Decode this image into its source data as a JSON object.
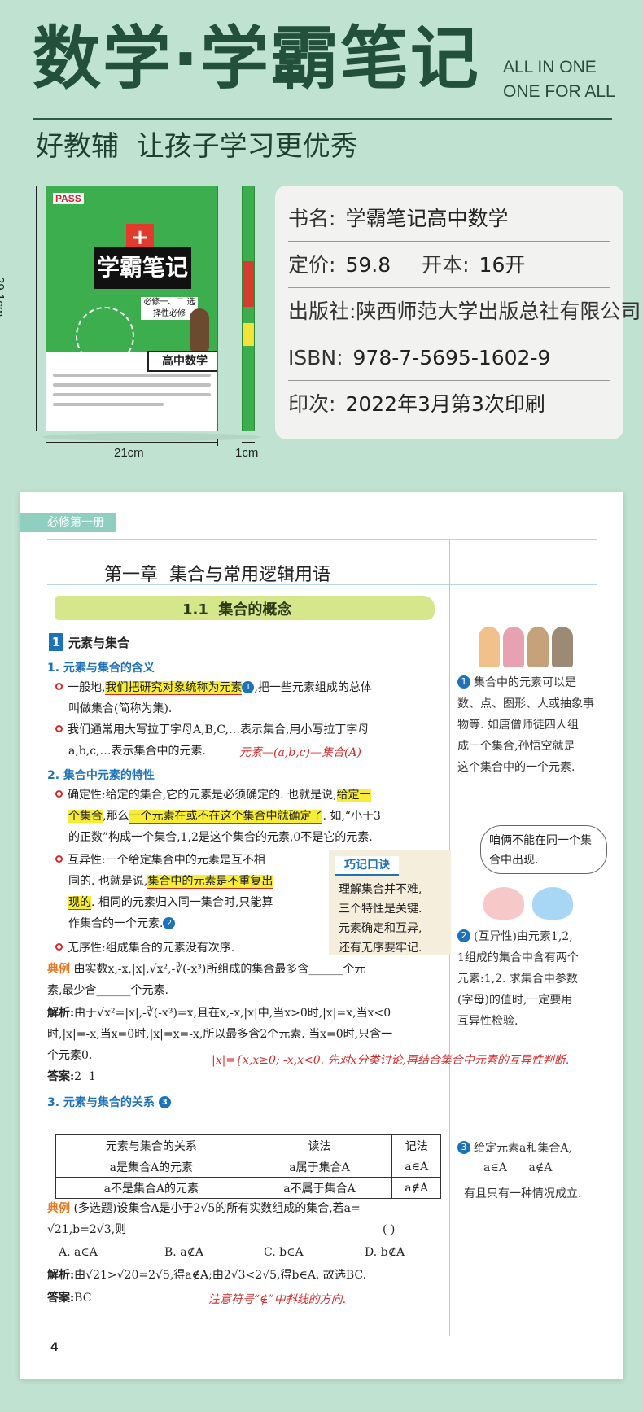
{
  "header": {
    "title": "数学·学霸笔记",
    "slogan_line1": "ALL IN ONE",
    "slogan_line2": "ONE FOR ALL",
    "subtitle": "好教辅  让孩子学习更优秀"
  },
  "book": {
    "cover_brand": "PASS",
    "cover_title": "学霸笔记",
    "cover_plus": "+",
    "cover_volume": "必修一、二 选择性必修",
    "cover_subject": "高中数学",
    "height_label": "29.1cm",
    "width_label": "21cm",
    "spine_label": "1cm"
  },
  "info": {
    "name_key": "书名:",
    "name_val": "学霸笔记高中数学",
    "price_key": "定价:",
    "price_val": "59.8",
    "format_key": "开本:",
    "format_val": "16开",
    "publisher": "出版社:陕西师范大学出版总社有限公司",
    "isbn_key": "ISBN:",
    "isbn_val": "978-7-5695-1602-9",
    "print_key": "印次:",
    "print_val": "2022年3月第3次印刷"
  },
  "page": {
    "tab": "必修第一册",
    "chapter": "第一章  集合与常用逻辑用语",
    "section": "1.1  集合的概念",
    "block_num": "1",
    "block_title": "元素与集合",
    "h1": "1. 元素与集合的含义",
    "p1a_pre": "一般地,",
    "p1a_hl": "我们把研究对象统称为元素",
    "p1a_post": ",把一些元素组成的总体",
    "p1b": "叫做集合(简称为集).",
    "p2a": "我们通常用大写拉丁字母A,B,C,…表示集合,用小写拉丁字母",
    "p2b": "a,b,c,…表示集合中的元素.",
    "note1": "元素—(a,b,c)—集合(A)",
    "h2": "2. 集合中元素的特性",
    "p3a_pre": "确定性:给定的集合,它的元素是必须确定的. 也就是说,",
    "p3a_hl": "给定一",
    "p3b_hl1": "个集合",
    "p3b_mid": ",那么",
    "p3b_hl2": "一个元素在或不在这个集合中就确定了",
    "p3b_post": ". 如,“小于3",
    "p3c": "的正数”构成一个集合,1,2是这个集合的元素,0不是它的元素.",
    "p4a": "互异性:一个给定集合中的元素是互不相",
    "p4b_pre": "同的. 也就是说,",
    "p4b_hl": "集合中的元素是不重复出",
    "p4c_hl": "现的",
    "p4c_post": ". 相同的元素归入同一集合时,只能算",
    "p4d": "作集合的一个元素.",
    "p5": "无序性:组成集合的元素没有次序.",
    "tip_tag": "巧记口诀",
    "tip_lines": [
      "理解集合并不难,",
      "三个特性是关键.",
      "元素确定和互异,",
      "还有无序要牢记."
    ],
    "ex_tag": "典例",
    "ex1a": "由实数x,-x,|x|,√x²,-∛(-x³)所组成的集合最多含______个元",
    "ex1b": "素,最少含______个元素.",
    "sol_tag": "解析:",
    "sol1a": "由于√x²=|x|,-∛(-x³)=x,且在x,-x,|x|中,当x>0时,|x|=x,当x<0",
    "sol1b": "时,|x|=-x,当x=0时,|x|=x=-x,所以最多含2个元素. 当x=0时,只含一",
    "sol1c": "个元素0.",
    "note2": "|x|={x,x≥0; -x,x<0.  先对x分类讨论,再结合集合中元素的互异性判断.",
    "ans_tag": "答案:",
    "ans1": "2  1",
    "h3": "3. 元素与集合的关系",
    "table_headers": [
      "元素与集合的关系",
      "读法",
      "记法"
    ],
    "table_rows": [
      [
        "a是集合A的元素",
        "a属于集合A",
        "a∈A"
      ],
      [
        "a不是集合A的元素",
        "a不属于集合A",
        "a∉A"
      ]
    ],
    "ex2a": "(多选题)设集合A是小于2√5的所有实数组成的集合,若a=",
    "ex2b": "√21,b=2√3,则",
    "ex2_paren": "(    )",
    "opts": [
      "A. a∈A",
      "B. a∉A",
      "C. b∈A",
      "D. b∉A"
    ],
    "sol2": "由√21>√20=2√5,得a∉A;由2√3<2√5,得b∈A. 故选BC.",
    "ans2": "BC",
    "note3": "注意符号“∉”中斜线的方向.",
    "side1": [
      "集合中的元素可以是",
      "数、点、图形、人或抽象事",
      "物等. 如唐僧师徒四人组",
      "成一个集合,孙悟空就是",
      "这个集合中的一个元素."
    ],
    "side1_num": "1",
    "cloud": "咱俩不能在同一个集合中出现.",
    "side2": [
      "(互异性)由元素1,2,",
      "1组成的集合中含有两个",
      "元素:1,2. 求集合中参数",
      "(字母)的值时,一定要用",
      "互异性检验."
    ],
    "side2_num": "2",
    "side3": [
      "给定元素a和集合A,",
      "a∈A      a∉A",
      "有且只有一种情况成立."
    ],
    "side3_num": "3",
    "page_no": "4"
  }
}
